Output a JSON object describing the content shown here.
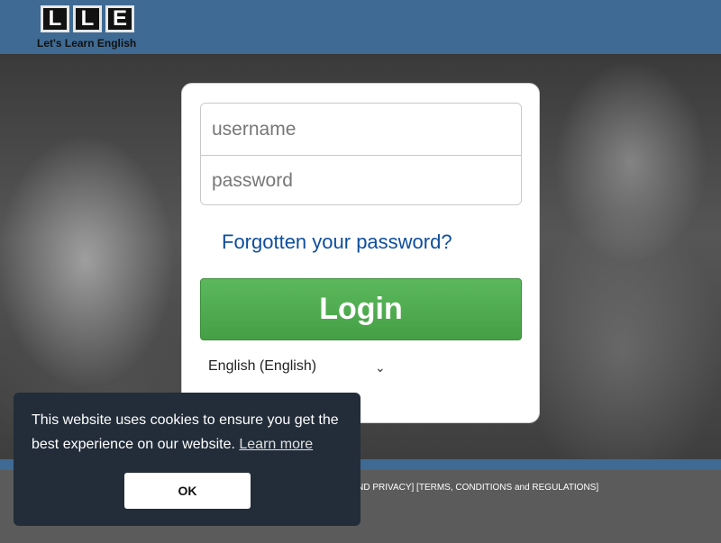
{
  "header": {
    "logo_letters": [
      "L",
      "L",
      "E"
    ],
    "logo_text": "Let's Learn English"
  },
  "login": {
    "username_placeholder": "username",
    "password_placeholder": "password",
    "forgot_label": "Forgotten your password?",
    "login_label": "Login",
    "language_selected": "English (English)"
  },
  "footer": {
    "links_text": "N AND PRIVACY] [TERMS, CONDITIONS and REGULATIONS]"
  },
  "cookie": {
    "message": "This website uses cookies to ensure you get the best experience on our website.",
    "learn_more_label": "Learn more",
    "ok_label": "OK"
  },
  "colors": {
    "header_bg": "#3f6a93",
    "login_button": "#5cb85c",
    "link": "#0e4e9b",
    "cookie_bg": "#222d39"
  }
}
